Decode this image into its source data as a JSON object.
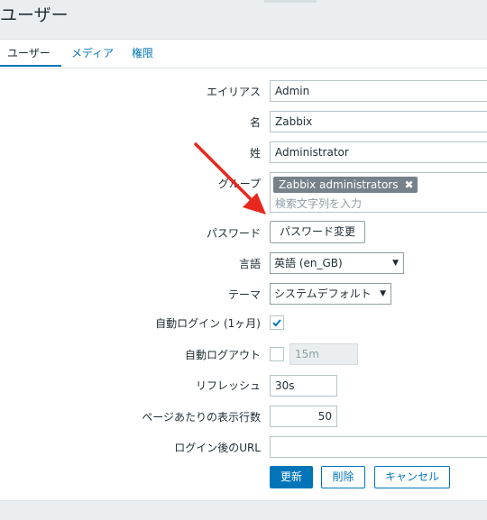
{
  "page": {
    "title": "ユーザー"
  },
  "tabs": [
    {
      "label": "ユーザー",
      "active": true
    },
    {
      "label": "メディア",
      "active": false
    },
    {
      "label": "権限",
      "active": false
    }
  ],
  "form": {
    "alias": {
      "label": "エイリアス",
      "value": "Admin"
    },
    "name": {
      "label": "名",
      "value": "Zabbix"
    },
    "surname": {
      "label": "姓",
      "value": "Administrator"
    },
    "groups": {
      "label": "グループ",
      "tag": "Zabbix administrators",
      "remove_glyph": "✖",
      "placeholder": "検索文字列を入力"
    },
    "password": {
      "label": "パスワード",
      "button": "パスワード変更"
    },
    "language": {
      "label": "言語",
      "value": "英語 (en_GB)"
    },
    "theme": {
      "label": "テーマ",
      "value": "システムデフォルト"
    },
    "autologin": {
      "label": "自動ログイン (1ヶ月)",
      "checked": true
    },
    "autologout": {
      "label": "自動ログアウト",
      "checked": false,
      "value": "15m"
    },
    "refresh": {
      "label": "リフレッシュ",
      "value": "30s"
    },
    "rows_per_page": {
      "label": "ページあたりの表示行数",
      "value": "50"
    },
    "url": {
      "label": "ログイン後のURL",
      "value": ""
    }
  },
  "actions": {
    "update": "更新",
    "delete": "削除",
    "cancel": "キャンセル"
  },
  "icons": {
    "caret": "▼",
    "check": "check-icon",
    "arrow": "arrow-annotation"
  },
  "colors": {
    "accent": "#0275b8",
    "arrow": "#e8281e"
  }
}
